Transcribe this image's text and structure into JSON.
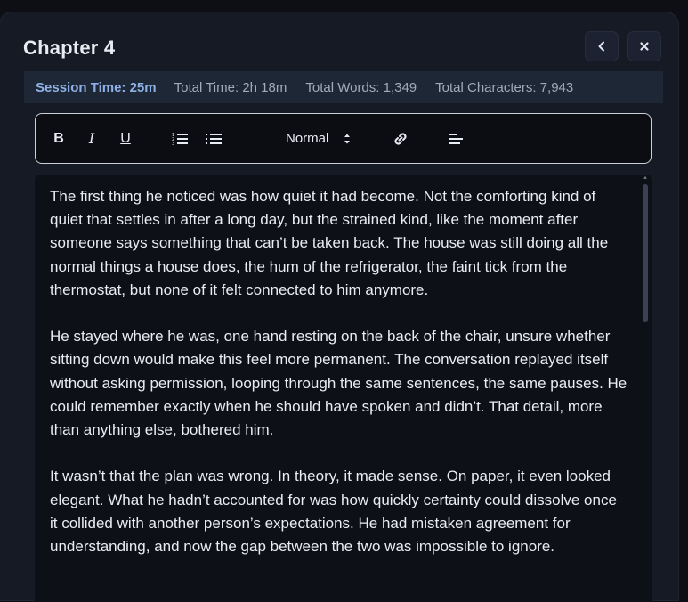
{
  "header": {
    "title": "Chapter 4",
    "back_icon": "chevron-left-icon",
    "close_icon": "close-icon"
  },
  "stats": {
    "session": "Session Time: 25m",
    "total_time": "Total Time: 2h 18m",
    "total_words": "Total Words: 1,349",
    "total_characters": "Total Characters: 7,943"
  },
  "toolbar": {
    "bold": "B",
    "italic": "I",
    "underline": "U",
    "format_select": "Normal",
    "icons": [
      "bold-icon",
      "italic-icon",
      "underline-icon",
      "ordered-list-icon",
      "bullet-list-icon",
      "link-icon",
      "align-icon"
    ]
  },
  "editor": {
    "paragraphs": [
      "The first thing he noticed was how quiet it had become. Not the comforting kind of quiet that settles in after a long day, but the strained kind, like the moment after someone says something that can’t be taken back. The house was still doing all the normal things a house does, the hum of the refrigerator, the faint tick from the thermostat, but none of it felt connected to him anymore.",
      "He stayed where he was, one hand resting on the back of the chair, unsure whether sitting down would make this feel more permanent. The conversation replayed itself without asking permission, looping through the same sentences, the same pauses. He could remember exactly when he should have spoken and didn’t. That detail, more than anything else, bothered him.",
      "It wasn’t that the plan was wrong. In theory, it made sense. On paper, it even looked elegant. What he hadn’t accounted for was how quickly certainty could dissolve once it collided with another person’s expectations. He had mistaken agreement for understanding, and now the gap between the two was impossible to ignore."
    ]
  },
  "colors": {
    "background": "#161a24",
    "stats_bar": "#1e2736",
    "session_accent": "#8fb1e6",
    "editor_bg": "#0d1016",
    "text": "#e9ecf2"
  }
}
